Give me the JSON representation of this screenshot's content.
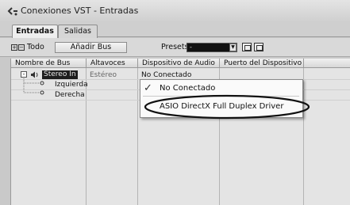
{
  "window": {
    "title": "Conexiones VST - Entradas"
  },
  "tabs": [
    {
      "label": "Entradas"
    },
    {
      "label": "Salidas"
    }
  ],
  "toolbar": {
    "todo_label": "Todo",
    "add_bus_label": "Añadir Bus",
    "presets_label": "Presets",
    "presets_value": "-"
  },
  "table": {
    "columns": [
      "Nombre de Bus",
      "Altavoces",
      "Dispositivo de Audio",
      "Puerto del Dispositivo"
    ],
    "bus": {
      "name": "Stereo In",
      "speakers": "Estéreo",
      "device": "No Conectado"
    },
    "channels": [
      "Izquierda",
      "Derecha"
    ]
  },
  "dropdown": {
    "items": [
      {
        "label": "No Conectado",
        "checked": true
      },
      {
        "label": "ASIO DirectX Full Duplex Driver",
        "checked": false
      }
    ]
  }
}
